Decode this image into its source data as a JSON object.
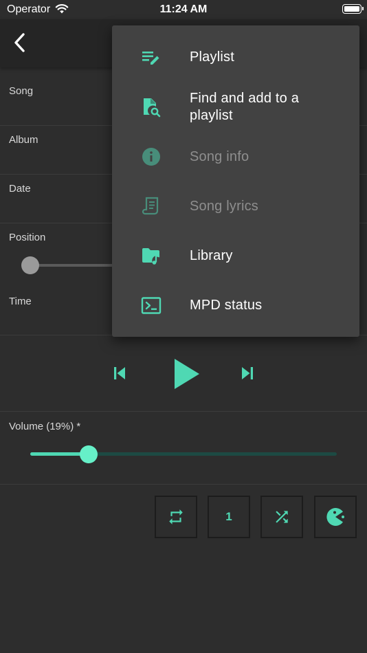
{
  "status_bar": {
    "carrier": "Operator",
    "time": "11:24 AM"
  },
  "fields": {
    "song_label": "Song",
    "album_label": "Album",
    "date_label": "Date",
    "position_label": "Position",
    "time_label": "Time"
  },
  "position_slider": {
    "value": 0
  },
  "volume": {
    "label": "Volume (19%) *",
    "level_percent": 19
  },
  "modes": {
    "single_label": "1"
  },
  "menu": {
    "items": [
      {
        "label": "Playlist",
        "icon": "playlist-edit-icon",
        "enabled": true
      },
      {
        "label": "Find and add to a playlist",
        "icon": "file-search-icon",
        "enabled": true
      },
      {
        "label": "Song info",
        "icon": "info-icon",
        "enabled": false
      },
      {
        "label": "Song lyrics",
        "icon": "script-text-icon",
        "enabled": false
      },
      {
        "label": "Library",
        "icon": "folder-music-icon",
        "enabled": true
      },
      {
        "label": "MPD status",
        "icon": "console-icon",
        "enabled": true
      }
    ]
  },
  "colors": {
    "accent": "#4fd8b3",
    "background": "#2d2d2d",
    "menu_background": "#424242",
    "appbar": "#252525"
  }
}
